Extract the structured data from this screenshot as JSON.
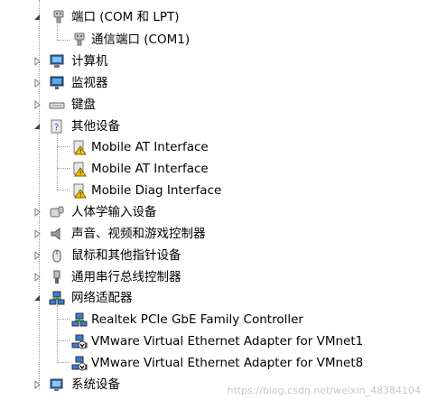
{
  "tree": {
    "ports": {
      "label": "端口 (COM 和 LPT)",
      "child": "通信端口 (COM1)"
    },
    "computer": "计算机",
    "monitors": "监视器",
    "keyboards": "键盘",
    "other": {
      "label": "其他设备",
      "children": [
        "Mobile AT Interface",
        "Mobile AT Interface",
        "Mobile Diag Interface"
      ]
    },
    "hid": "人体学输入设备",
    "sound": "声音、视频和游戏控制器",
    "mice": "鼠标和其他指针设备",
    "usb": "通用串行总线控制器",
    "network": {
      "label": "网络适配器",
      "children": [
        "Realtek PCIe GbE Family Controller",
        "VMware Virtual Ethernet Adapter for VMnet1",
        "VMware Virtual Ethernet Adapter for VMnet8"
      ]
    },
    "system": "系统设备"
  },
  "watermark": "https://blog.csdn.net/weixin_48384104"
}
